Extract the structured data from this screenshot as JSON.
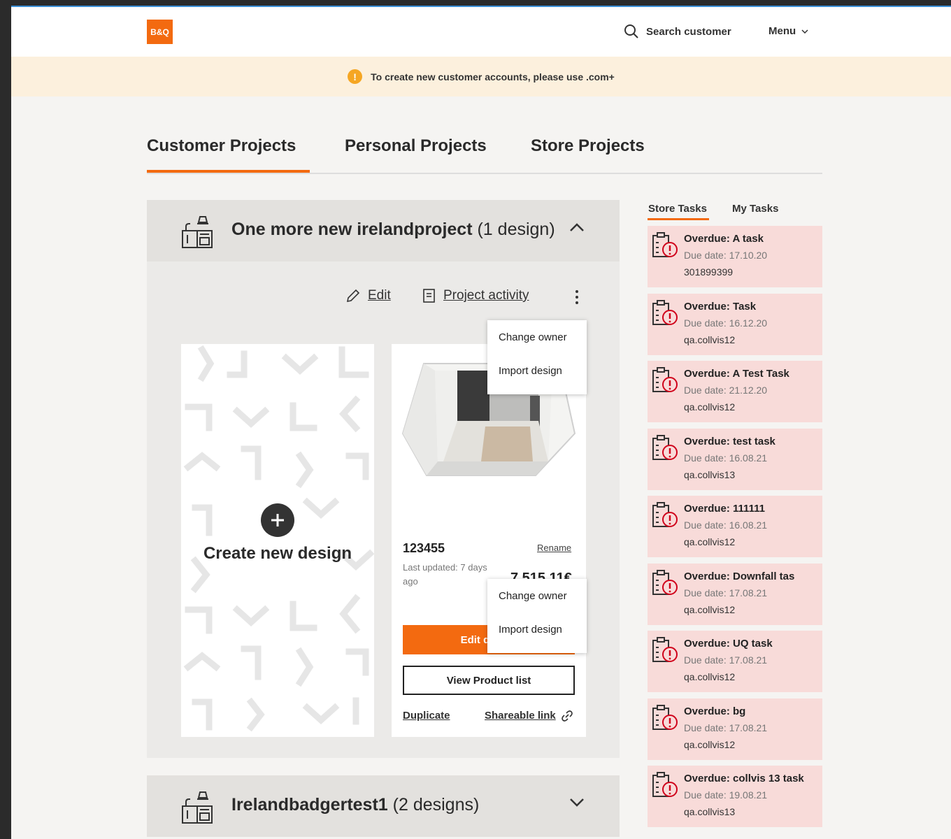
{
  "header": {
    "logo_text": "B&Q",
    "search_label": "Search customer",
    "menu_label": "Menu"
  },
  "banner": {
    "icon": "!",
    "text": "To create new customer accounts, please use .com+"
  },
  "tabs": [
    {
      "label": "Customer Projects",
      "active": true
    },
    {
      "label": "Personal Projects",
      "active": false
    },
    {
      "label": "Store Projects",
      "active": false
    }
  ],
  "project1": {
    "title": "One more new irelandproject",
    "count": "(1 design)",
    "actions": {
      "edit": "Edit",
      "activity": "Project activity"
    },
    "create_label": "Create new design",
    "design": {
      "name": "123455",
      "rename": "Rename",
      "updated": "Last updated: 7 days ago",
      "price": "7 515.11€",
      "edit_button": "Edit design",
      "view_list": "View Product list",
      "duplicate": "Duplicate",
      "shareable": "Shareable link"
    },
    "dropdown": [
      "Change owner",
      "Import design"
    ]
  },
  "project2": {
    "title": "Irelandbadgertest1",
    "count": "(2 designs)"
  },
  "task_tabs": [
    {
      "label": "Store Tasks",
      "active": true
    },
    {
      "label": "My Tasks",
      "active": false
    }
  ],
  "tasks": [
    {
      "title": "Overdue: A task",
      "due": "Due date: 17.10.20",
      "user": "301899399"
    },
    {
      "title": "Overdue: Task",
      "due": "Due date: 16.12.20",
      "user": "qa.collvis12"
    },
    {
      "title": "Overdue: A Test Task",
      "due": "Due date: 21.12.20",
      "user": "qa.collvis12"
    },
    {
      "title": "Overdue: test task",
      "due": "Due date: 16.08.21",
      "user": "qa.collvis13"
    },
    {
      "title": "Overdue: 111111",
      "due": "Due date: 16.08.21",
      "user": "qa.collvis12"
    },
    {
      "title": "Overdue: Downfall tas",
      "due": "Due date: 17.08.21",
      "user": "qa.collvis12"
    },
    {
      "title": "Overdue: UQ task",
      "due": "Due date: 17.08.21",
      "user": "qa.collvis12"
    },
    {
      "title": "Overdue: bg",
      "due": "Due date: 17.08.21",
      "user": "qa.collvis12"
    },
    {
      "title": "Overdue: collvis 13 task",
      "due": "Due date: 19.08.21",
      "user": "qa.collvis13"
    }
  ],
  "colors": {
    "accent": "#f36a10",
    "task_bg": "#f8dbd9",
    "banner_bg": "#fcf0dd"
  }
}
